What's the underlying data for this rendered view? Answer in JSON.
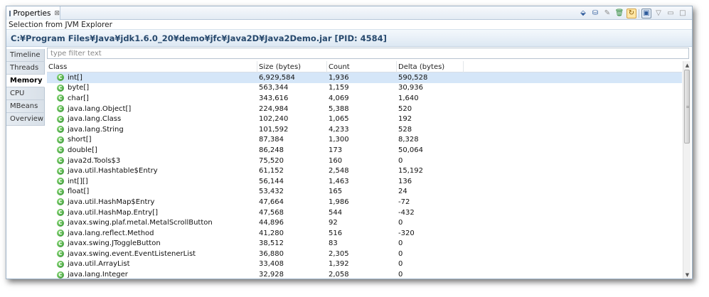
{
  "view": {
    "tab_label": "Properties",
    "tab_close": "⊠"
  },
  "toolbar": {
    "icons": [
      "gc-icon",
      "heap-dump-icon",
      "clear-icon",
      "trash-icon",
      "refresh-icon",
      "pin-icon",
      "menu-icon",
      "minimize-icon",
      "maximize-icon"
    ],
    "glyphs": [
      "⬙",
      "⛁",
      "✎",
      "🗑",
      "↻",
      "▣",
      "▽",
      "▭",
      "□"
    ]
  },
  "selection_label": "Selection from JVM Explorer",
  "jvm_title": "C:¥Program Files¥Java¥jdk1.6.0_20¥demo¥jfc¥Java2D¥Java2Demo.jar [PID: 4584]",
  "side_tabs": [
    {
      "label": "Timeline",
      "active": false
    },
    {
      "label": "Threads",
      "active": false
    },
    {
      "label": "Memory",
      "active": true
    },
    {
      "label": "CPU",
      "active": false
    },
    {
      "label": "MBeans",
      "active": false
    },
    {
      "label": "Overview",
      "active": false
    }
  ],
  "filter": {
    "placeholder": "type filter text",
    "value": ""
  },
  "table": {
    "columns": [
      "Class",
      "Size (bytes)",
      "Count",
      "Delta (bytes)"
    ],
    "icon_glyph": "C",
    "rows": [
      [
        "int[]",
        "6,929,584",
        "1,936",
        "590,528"
      ],
      [
        "byte[]",
        "563,344",
        "1,159",
        "30,936"
      ],
      [
        "char[]",
        "343,616",
        "4,069",
        "1,640"
      ],
      [
        "java.lang.Object[]",
        "224,984",
        "5,388",
        "520"
      ],
      [
        "java.lang.Class",
        "102,240",
        "1,065",
        "192"
      ],
      [
        "java.lang.String",
        "101,592",
        "4,233",
        "528"
      ],
      [
        "short[]",
        "87,384",
        "1,300",
        "8,328"
      ],
      [
        "double[]",
        "86,248",
        "173",
        "50,064"
      ],
      [
        "java2d.Tools$3",
        "75,520",
        "160",
        "0"
      ],
      [
        "java.util.Hashtable$Entry",
        "61,152",
        "2,548",
        "15,192"
      ],
      [
        "int[][]",
        "56,144",
        "1,463",
        "136"
      ],
      [
        "float[]",
        "53,432",
        "165",
        "24"
      ],
      [
        "java.util.HashMap$Entry",
        "47,664",
        "1,986",
        "-72"
      ],
      [
        "java.util.HashMap.Entry[]",
        "47,568",
        "544",
        "-432"
      ],
      [
        "javax.swing.plaf.metal.MetalScrollButton",
        "44,896",
        "92",
        "0"
      ],
      [
        "java.lang.reflect.Method",
        "41,280",
        "516",
        "-320"
      ],
      [
        "javax.swing.JToggleButton",
        "38,512",
        "83",
        "0"
      ],
      [
        "javax.swing.event.EventListenerList",
        "36,880",
        "2,305",
        "0"
      ],
      [
        "java.util.ArrayList",
        "33,408",
        "1,392",
        "0"
      ],
      [
        "java.lang.Integer",
        "32,928",
        "2,058",
        "0"
      ]
    ]
  },
  "scrollbar": {
    "up": "▲",
    "down": "▼",
    "grip": "≡"
  }
}
